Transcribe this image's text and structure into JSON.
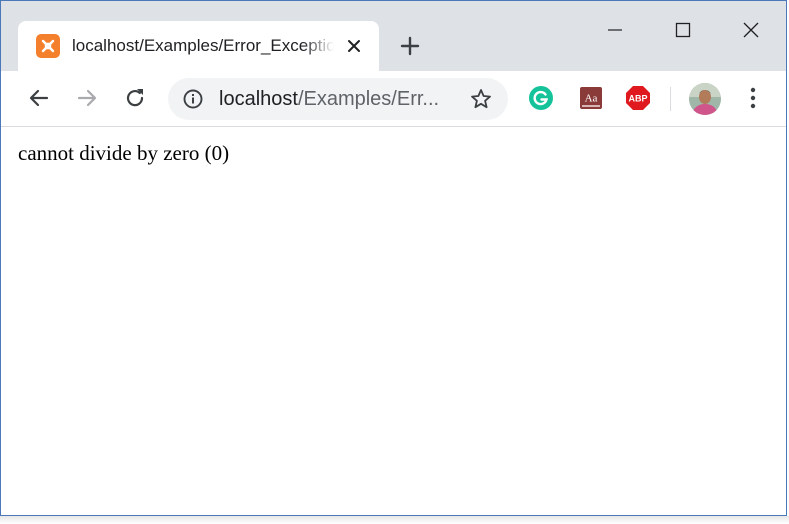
{
  "window": {
    "controls": {
      "minimize_icon": "minimize-icon",
      "maximize_icon": "maximize-icon",
      "close_icon": "close-icon"
    }
  },
  "tab": {
    "title": "localhost/Examples/Error_Exception_Handling",
    "favicon": "xampp-icon",
    "favicon_color": "#f47f2d"
  },
  "toolbar": {
    "omnibox": {
      "url_host": "localhost",
      "url_path": "/Examples/Err..."
    },
    "extensions": [
      {
        "name": "grammarly",
        "label": "G",
        "color": "#15c39a"
      },
      {
        "name": "dictionary",
        "label": "Aa",
        "color": "#8b3a3a"
      },
      {
        "name": "adblock-plus",
        "label": "ABP",
        "color": "#e0191e"
      }
    ]
  },
  "page": {
    "text": "cannot divide by zero (0)"
  }
}
